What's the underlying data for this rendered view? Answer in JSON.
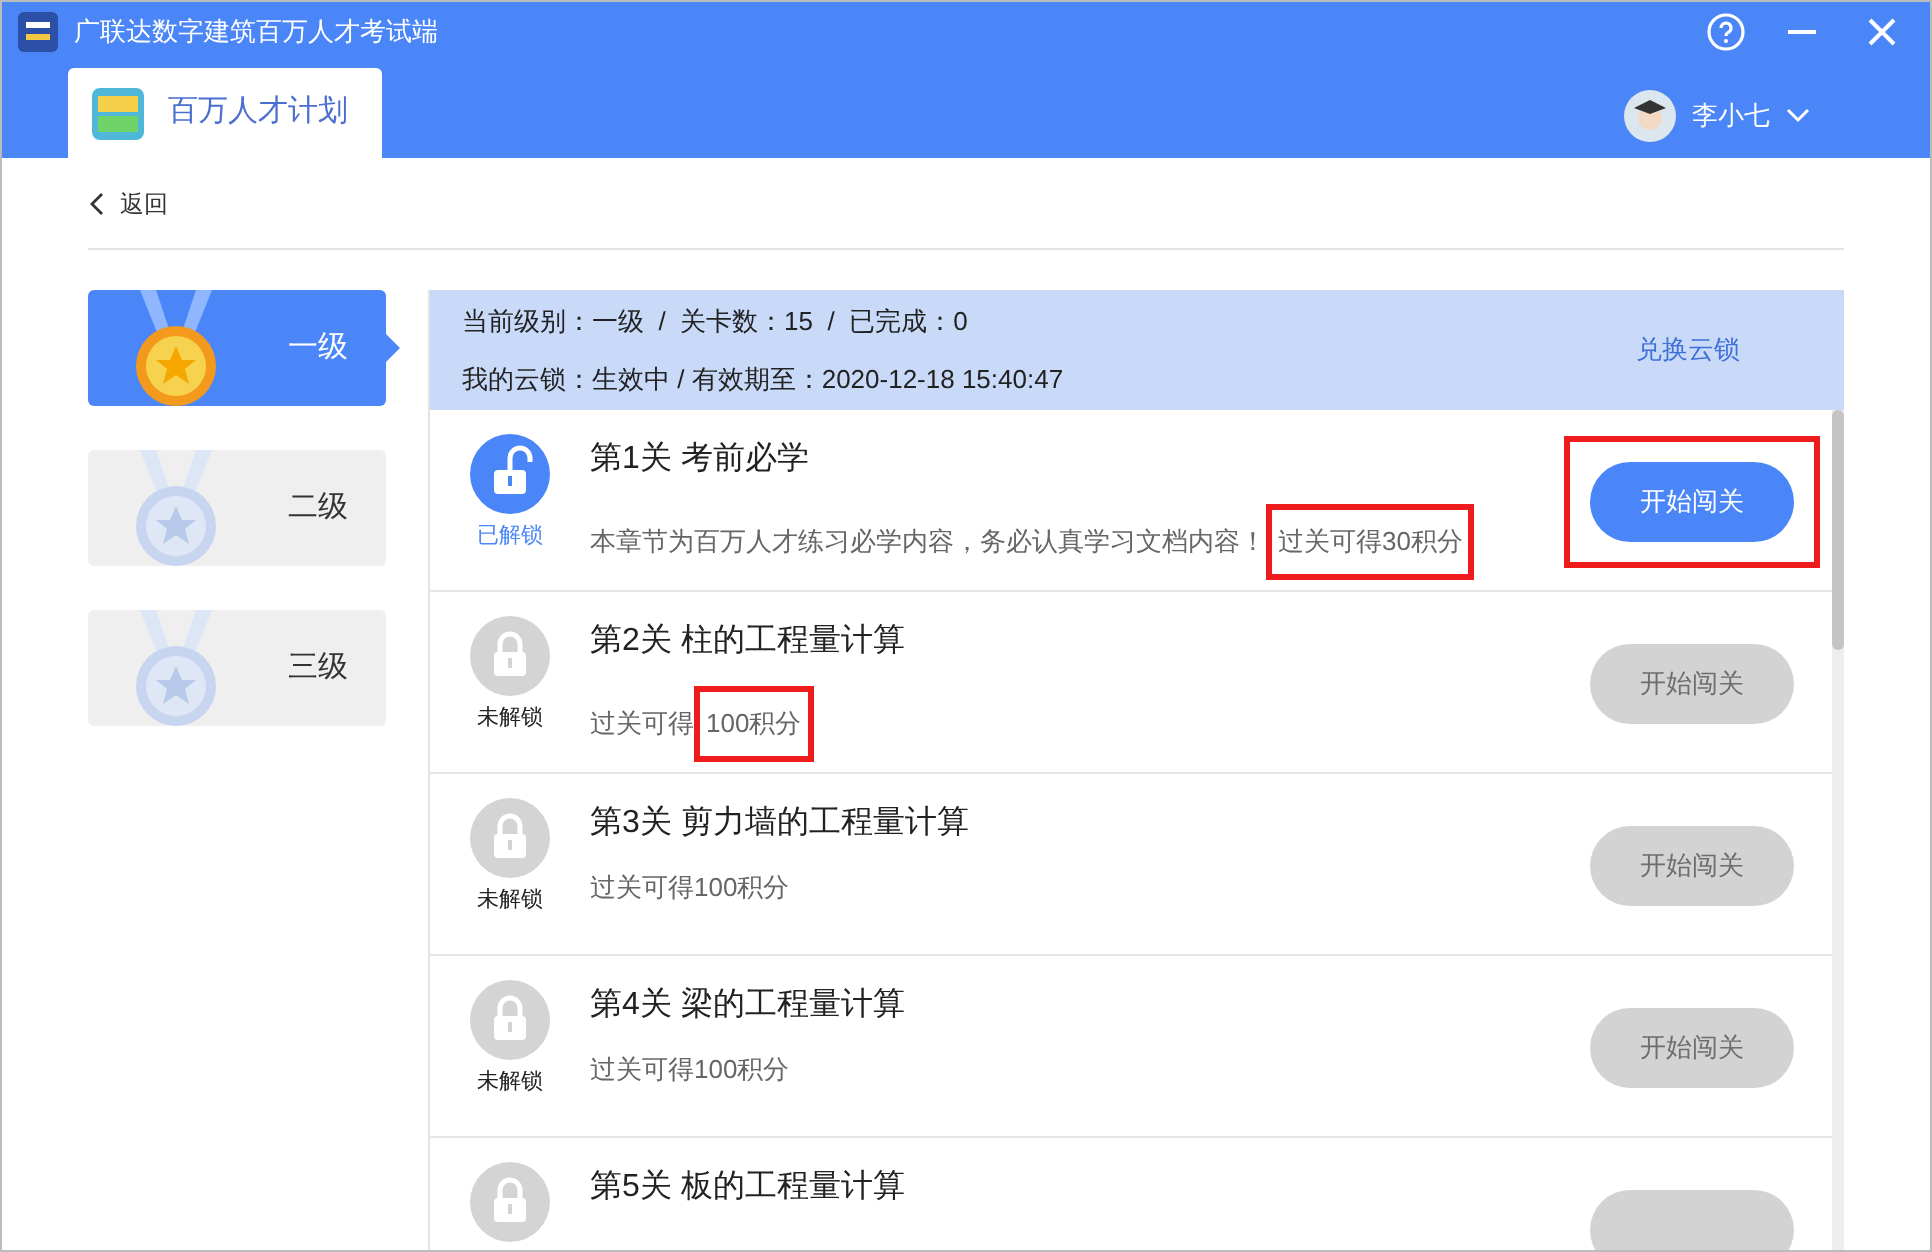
{
  "window": {
    "title": "广联达数字建筑百万人才考试端"
  },
  "tab": {
    "label": "百万人才计划",
    "selected": true
  },
  "user": {
    "name": "李小七"
  },
  "back": {
    "label": "返回"
  },
  "levels": [
    {
      "label": "一级",
      "selected": true,
      "medal_lit": true
    },
    {
      "label": "二级",
      "selected": false,
      "medal_lit": false
    },
    {
      "label": "三级",
      "selected": false,
      "medal_lit": false
    }
  ],
  "summary": {
    "line_1": "当前级别：一级  /  关卡数：15  /  已完成：0",
    "line_2": "我的云锁：生效中 / 有效期至：2020-12-18 15:40:47",
    "action": "兑换云锁"
  },
  "stages": [
    {
      "title": "第1关 考前必学",
      "unlocked": true,
      "status": "已解锁",
      "description": "本章节为百万人才练习必学内容，务必认真学习文档内容！",
      "reward": [
        {
          "text": "过关可得30积分",
          "highlighted": true
        }
      ],
      "button": {
        "label": "开始闯关",
        "disabled": false,
        "highlighted": true
      }
    },
    {
      "title": "第2关 柱的工程量计算",
      "unlocked": false,
      "status": "未解锁",
      "reward": [
        {
          "text": "过关可得",
          "highlighted": false
        },
        {
          "text": "100积分",
          "highlighted": true
        }
      ],
      "button": {
        "label": "开始闯关",
        "disabled": true,
        "highlighted": false
      }
    },
    {
      "title": "第3关 剪力墙的工程量计算",
      "unlocked": false,
      "status": "未解锁",
      "reward": [
        {
          "text": "过关可得100积分",
          "highlighted": false
        }
      ],
      "button": {
        "label": "开始闯关",
        "disabled": true,
        "highlighted": false
      }
    },
    {
      "title": "第4关 梁的工程量计算",
      "unlocked": false,
      "status": "未解锁",
      "reward": [
        {
          "text": "过关可得100积分",
          "highlighted": false
        }
      ],
      "button": {
        "label": "开始闯关",
        "disabled": true,
        "highlighted": false
      }
    },
    {
      "title": "第5关 板的工程量计算",
      "unlocked": false,
      "button": {
        "disabled": true,
        "highlighted": false
      }
    }
  ]
}
